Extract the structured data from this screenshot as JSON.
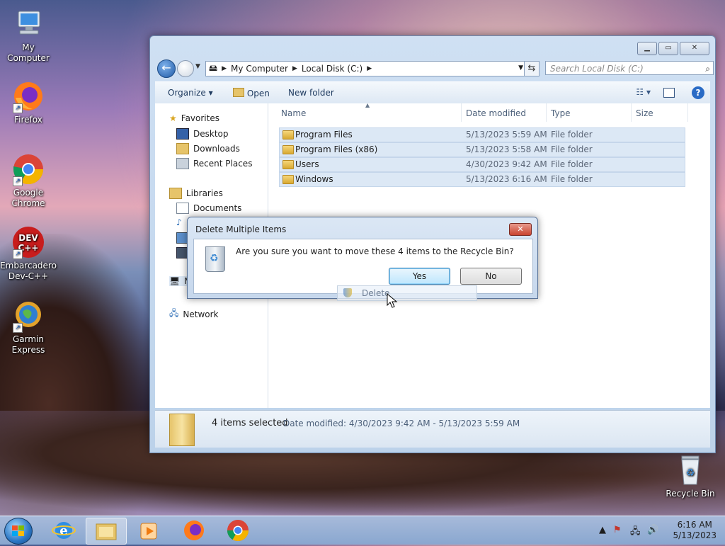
{
  "desktop": {
    "icons": [
      {
        "label": "My Computer"
      },
      {
        "label": "Firefox"
      },
      {
        "label": "Google Chrome"
      },
      {
        "label": "Embarcadero Dev-C++"
      },
      {
        "label": "Garmin Express"
      },
      {
        "label": "Recycle Bin"
      }
    ]
  },
  "explorer": {
    "address": {
      "crumbs": [
        "My Computer",
        "Local Disk (C:)"
      ]
    },
    "search_placeholder": "Search Local Disk (C:)",
    "toolbar": {
      "organize": "Organize",
      "open": "Open",
      "new_folder": "New folder"
    },
    "nav": {
      "favorites": "Favorites",
      "favorites_items": [
        "Desktop",
        "Downloads",
        "Recent Places"
      ],
      "libraries": "Libraries",
      "libraries_items": [
        "Documents"
      ],
      "partial_item": "M",
      "network": "Network"
    },
    "columns": {
      "name": "Name",
      "date": "Date modified",
      "type": "Type",
      "size": "Size"
    },
    "files": [
      {
        "name": "Program Files",
        "date": "5/13/2023 5:59 AM",
        "type": "File folder"
      },
      {
        "name": "Program Files (x86)",
        "date": "5/13/2023 5:58 AM",
        "type": "File folder"
      },
      {
        "name": "Users",
        "date": "4/30/2023 9:42 AM",
        "type": "File folder"
      },
      {
        "name": "Windows",
        "date": "5/13/2023 6:16 AM",
        "type": "File folder"
      }
    ],
    "details": {
      "selected": "4 items selected",
      "date_modified": "Date modified: 4/30/2023 9:42 AM - 5/13/2023 5:59 AM"
    }
  },
  "dialog": {
    "title": "Delete Multiple Items",
    "message": "Are you sure you want to move these 4 items to the Recycle Bin?",
    "yes": "Yes",
    "no": "No"
  },
  "ghost_menu": {
    "label": "Delete"
  },
  "taskbar": {
    "clock_time": "6:16 AM",
    "clock_date": "5/13/2023"
  },
  "colors": {
    "accent": "#2a6bc5",
    "folder": "#e6c46a",
    "selection": "#dce8f5"
  }
}
